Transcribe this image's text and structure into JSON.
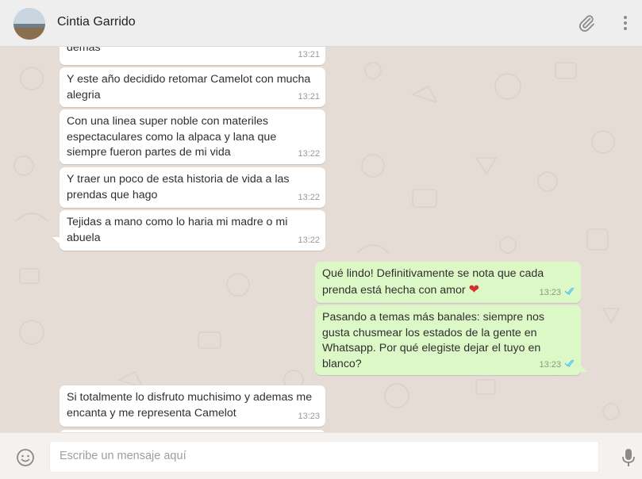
{
  "header": {
    "contact_name": "Cintia Garrido",
    "icons": [
      "avatar",
      "paperclip-icon",
      "menu-dots-icon"
    ]
  },
  "messages": [
    {
      "dir": "in",
      "text": "demas",
      "time": "13:21"
    },
    {
      "dir": "in",
      "text": "Y este año decidido retomar Camelot con mucha alegria",
      "time": "13:21"
    },
    {
      "dir": "in",
      "text": "Con una linea super noble con materiles espectaculares como la alpaca y lana que siempre fueron partes de mi vida",
      "time": "13:22"
    },
    {
      "dir": "in",
      "text": "Y traer un poco de esta historia de vida a las prendas que hago",
      "time": "13:22"
    },
    {
      "dir": "in",
      "text": "Tejidas a mano como lo haria mi madre o mi abuela",
      "time": "13:22"
    },
    {
      "dir": "out",
      "text": "Qué lindo! Definitivamente se nota que cada prenda está hecha con amor",
      "time": "13:23",
      "emoji": "❤",
      "status": "read"
    },
    {
      "dir": "out",
      "text": "Pasando a temas más banales: siempre nos gusta chusmear los estados de la gente en Whatsapp. Por qué elegiste dejar el tuyo en blanco?",
      "time": "13:23",
      "status": "read"
    },
    {
      "dir": "in",
      "text": "Si totalmente lo disfruto muchisimo y ademas me encanta y me representa Camelot",
      "time": "13:23"
    }
  ],
  "composer": {
    "placeholder": "Escribe un mensaje aquí",
    "icons": [
      "emoji-icon",
      "microphone-icon"
    ]
  },
  "colors": {
    "chat_bg": "#e5ddd5",
    "incoming_bubble": "#ffffff",
    "outgoing_bubble": "#dcf8c6",
    "read_ticks": "#4fc3f7",
    "header_bg": "#eeeeee"
  }
}
